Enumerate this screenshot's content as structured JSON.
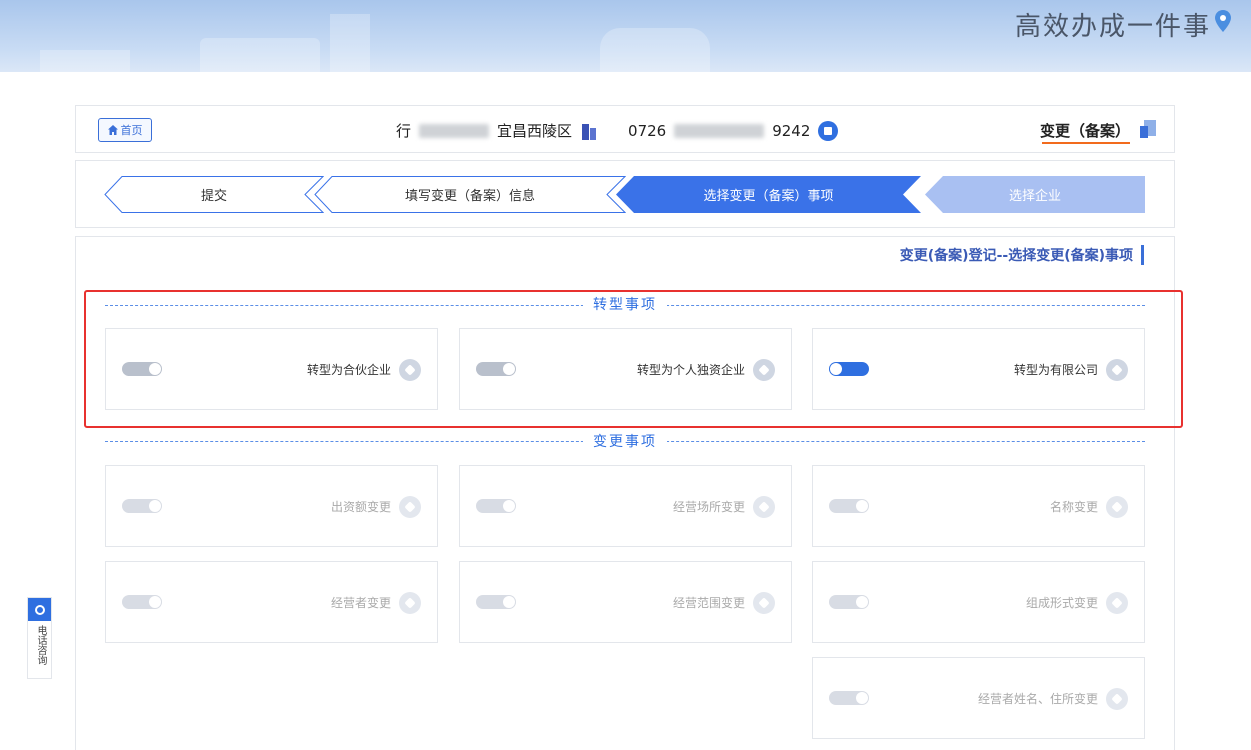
{
  "banner": {
    "title": "高效办成一件事"
  },
  "info_bar": {
    "home_label": "首页",
    "company_name_visible_start": "宜昌西陵区",
    "company_name_visible_end": "行",
    "credit_code_start": "9242",
    "credit_code_end": "0726",
    "business_type": "变更（备案）"
  },
  "steps": [
    {
      "label": "选择企业",
      "state": "done"
    },
    {
      "label": "选择变更（备案）事项",
      "state": "active"
    },
    {
      "label": "填写变更（备案）信息",
      "state": "pending"
    },
    {
      "label": "提交",
      "state": "pending"
    }
  ],
  "section_title": "变更(备案)登记--选择变更(备案)事项",
  "groups": [
    {
      "title": "转型事项",
      "items": [
        {
          "label": "转型为有限公司",
          "on": true,
          "disabled": false
        },
        {
          "label": "转型为个人独资企业",
          "on": false,
          "disabled": false
        },
        {
          "label": "转型为合伙企业",
          "on": false,
          "disabled": false
        }
      ]
    },
    {
      "title": "变更事项",
      "items": [
        {
          "label": "名称变更",
          "on": false,
          "disabled": true
        },
        {
          "label": "经营场所变更",
          "on": false,
          "disabled": true
        },
        {
          "label": "出资额变更",
          "on": false,
          "disabled": true
        },
        {
          "label": "组成形式变更",
          "on": false,
          "disabled": true
        },
        {
          "label": "经营范围变更",
          "on": false,
          "disabled": true
        },
        {
          "label": "经营者变更",
          "on": false,
          "disabled": true
        },
        {
          "label": "经营者姓名、住所变更",
          "on": false,
          "disabled": true
        }
      ]
    }
  ],
  "side_widget": {
    "label": "电话咨询"
  },
  "colors": {
    "primary": "#2f6fe0",
    "highlight": "#e8312f",
    "underline": "#f26b1d"
  }
}
